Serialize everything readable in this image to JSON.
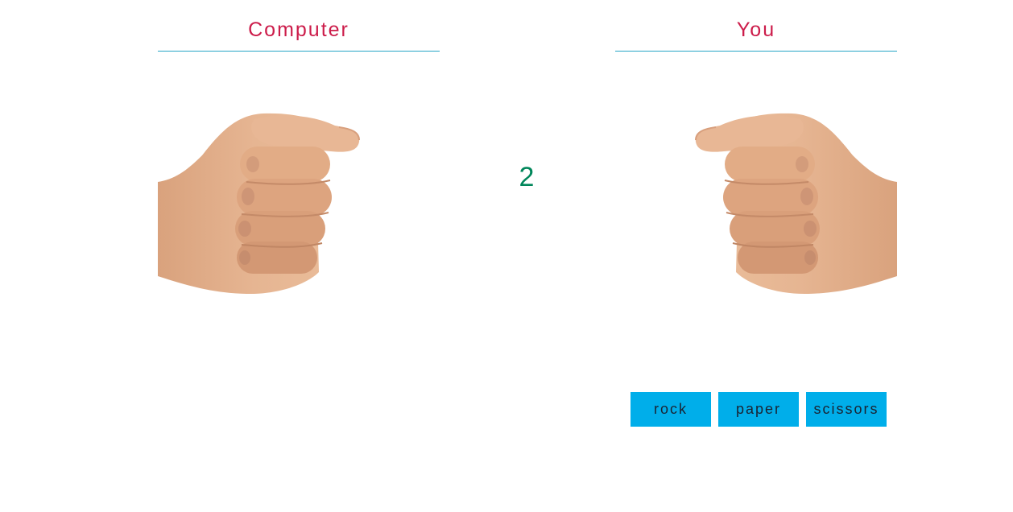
{
  "computer": {
    "title": "Computer",
    "hand": "rock-fist-icon"
  },
  "you": {
    "title": "You",
    "hand": "rock-fist-icon"
  },
  "countdown": "2",
  "choices": [
    {
      "label": "rock"
    },
    {
      "label": "paper"
    },
    {
      "label": "scissors"
    }
  ],
  "colors": {
    "title": "#cc1c4a",
    "rule": "#27a6c7",
    "countdown": "#00865a",
    "button": "#00aeea",
    "skin": "#e3b08c",
    "skin_shadow": "#c98e6b"
  }
}
